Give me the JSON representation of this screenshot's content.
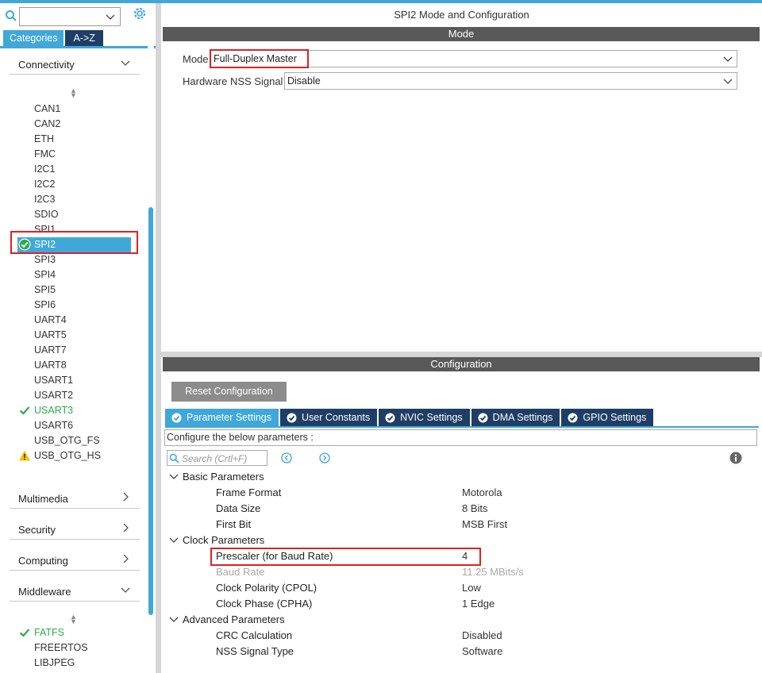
{
  "left": {
    "tabs": {
      "categories": "Categories",
      "az": "A->Z"
    },
    "categories": [
      {
        "label": "Connectivity"
      },
      {
        "label": "Multimedia"
      },
      {
        "label": "Security"
      },
      {
        "label": "Computing"
      },
      {
        "label": "Middleware"
      }
    ],
    "connectivity_items": [
      "CAN1",
      "CAN2",
      "ETH",
      "FMC",
      "I2C1",
      "I2C2",
      "I2C3",
      "SDIO",
      "SPI1",
      "SPI2",
      "SPI3",
      "SPI4",
      "SPI5",
      "SPI6",
      "UART4",
      "UART5",
      "UART7",
      "UART8",
      "USART1",
      "USART2",
      "USART3",
      "USART6",
      "USB_OTG_FS",
      "USB_OTG_HS"
    ],
    "middleware_items": [
      "FATFS",
      "FREERTOS",
      "LIBJPEG"
    ],
    "selected_item": "SPI2",
    "colors": {
      "accent": "#3fa8d8",
      "dark_tab": "#1f3e66",
      "ok_green": "#2eaa4a",
      "warn_yellow": "#f5c400",
      "highlight_red": "#dd2222"
    }
  },
  "main": {
    "title": "SPI2 Mode and Configuration",
    "mode_bar": "Mode",
    "mode": {
      "label": "Mode",
      "value": "Full-Duplex Master"
    },
    "nss": {
      "label": "Hardware NSS Signal",
      "value": "Disable"
    },
    "config_bar": "Configuration",
    "reset_button": "Reset Configuration",
    "tabs": [
      "Parameter Settings",
      "User Constants",
      "NVIC Settings",
      "DMA Settings",
      "GPIO Settings"
    ],
    "hint": "Configure the below parameters :",
    "search_placeholder": "Search (Crtl+F)",
    "groups": [
      {
        "name": "Basic Parameters",
        "params": [
          {
            "name": "Frame Format",
            "value": "Motorola"
          },
          {
            "name": "Data Size",
            "value": "8 Bits"
          },
          {
            "name": "First Bit",
            "value": "MSB First"
          }
        ]
      },
      {
        "name": "Clock Parameters",
        "params": [
          {
            "name": "Prescaler (for Baud Rate)",
            "value": "4"
          },
          {
            "name": "Baud Rate",
            "value": "11.25 MBits/s"
          },
          {
            "name": "Clock Polarity (CPOL)",
            "value": "Low"
          },
          {
            "name": "Clock Phase (CPHA)",
            "value": "1 Edge"
          }
        ]
      },
      {
        "name": "Advanced Parameters",
        "params": [
          {
            "name": "CRC Calculation",
            "value": "Disabled"
          },
          {
            "name": "NSS Signal Type",
            "value": "Software"
          }
        ]
      }
    ]
  }
}
